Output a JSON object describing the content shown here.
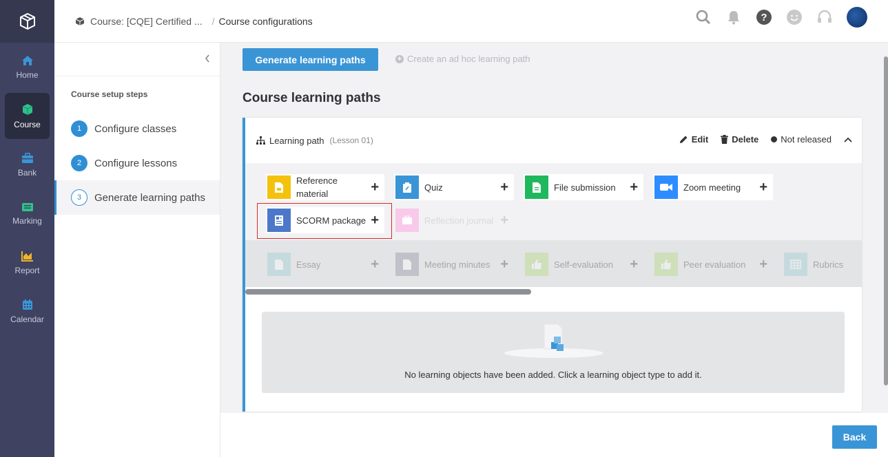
{
  "nav": {
    "items": [
      {
        "label": "Home",
        "icon": "home-icon"
      },
      {
        "label": "Course",
        "icon": "cube-icon"
      },
      {
        "label": "Bank",
        "icon": "briefcase-icon"
      },
      {
        "label": "Marking",
        "icon": "marking-icon"
      },
      {
        "label": "Report",
        "icon": "chart-icon"
      },
      {
        "label": "Calendar",
        "icon": "calendar-icon"
      }
    ],
    "active": "Course"
  },
  "header": {
    "breadcrumb_course": "Course: [CQE] Certified ...",
    "breadcrumb_separator": "/",
    "breadcrumb_current": "Course configurations"
  },
  "steps": {
    "title": "Course setup steps",
    "items": [
      {
        "num": "1",
        "label": "Configure classes"
      },
      {
        "num": "2",
        "label": "Configure lessons"
      },
      {
        "num": "3",
        "label": "Generate learning paths"
      }
    ]
  },
  "toolbar": {
    "generate_label": "Generate learning paths",
    "adhoc_label": "Create an ad hoc learning path"
  },
  "section_title": "Course learning paths",
  "learning_path": {
    "title": "Learning path",
    "lesson": "(Lesson 01)",
    "edit_label": "Edit",
    "delete_label": "Delete",
    "status": "Not released"
  },
  "tiles": {
    "reference": "Reference material",
    "quiz": "Quiz",
    "file": "File submission",
    "zoom": "Zoom meeting",
    "scorm": "SCORM package",
    "reflection": "Reflection journal",
    "essay": "Essay",
    "minutes": "Meeting minutes",
    "self_eval": "Self-evaluation",
    "peer_eval": "Peer evaluation",
    "rubrics": "Rubrics"
  },
  "empty_message": "No learning objects have been added. Click a learning object type to add it.",
  "footer": {
    "back_label": "Back"
  },
  "colors": {
    "accent": "#3a95d6",
    "nav_bg": "#3f4261",
    "highlight": "#d62b2b"
  }
}
